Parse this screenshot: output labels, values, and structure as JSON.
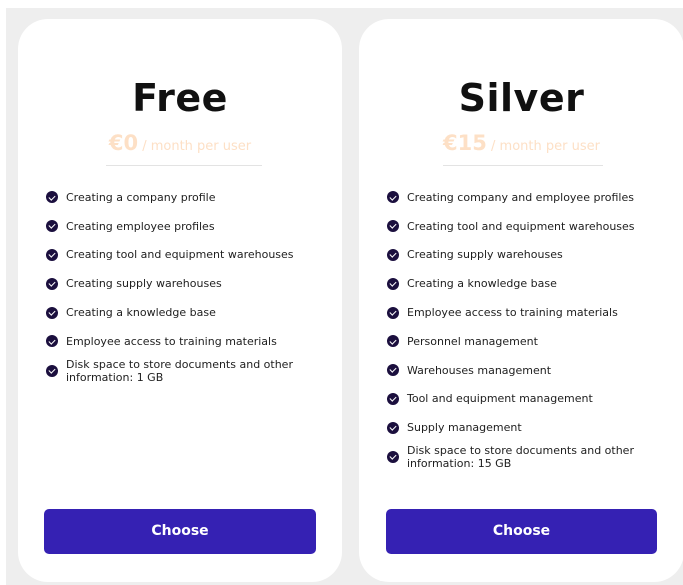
{
  "plans": [
    {
      "name": "Free",
      "price": "€0",
      "period": " / month per user",
      "features": [
        "Creating a company profile",
        "Creating employee profiles",
        "Creating tool and equipment warehouses",
        "Creating supply warehouses",
        "Creating a knowledge base",
        "Employee access to training materials",
        "Disk space to store documents and other information: 1 GB"
      ],
      "button_label": "Choose"
    },
    {
      "name": "Silver",
      "price": "€15",
      "period": " / month per user",
      "features": [
        "Creating company and employee profiles",
        "Creating tool and equipment warehouses",
        "Creating supply warehouses",
        "Creating a knowledge base",
        "Employee access to training materials",
        "Personnel management",
        "Warehouses management",
        "Tool and equipment management",
        "Supply management",
        "Disk space to store documents and other information: 15 GB"
      ],
      "button_label": "Choose"
    }
  ],
  "icons": {
    "feature_check": "check-circle-icon"
  },
  "colors": {
    "button_bg": "#3521b3",
    "price_text": "#fde0c6",
    "check_bg": "#1b0f3e",
    "page_bg": "#eeeeee"
  }
}
